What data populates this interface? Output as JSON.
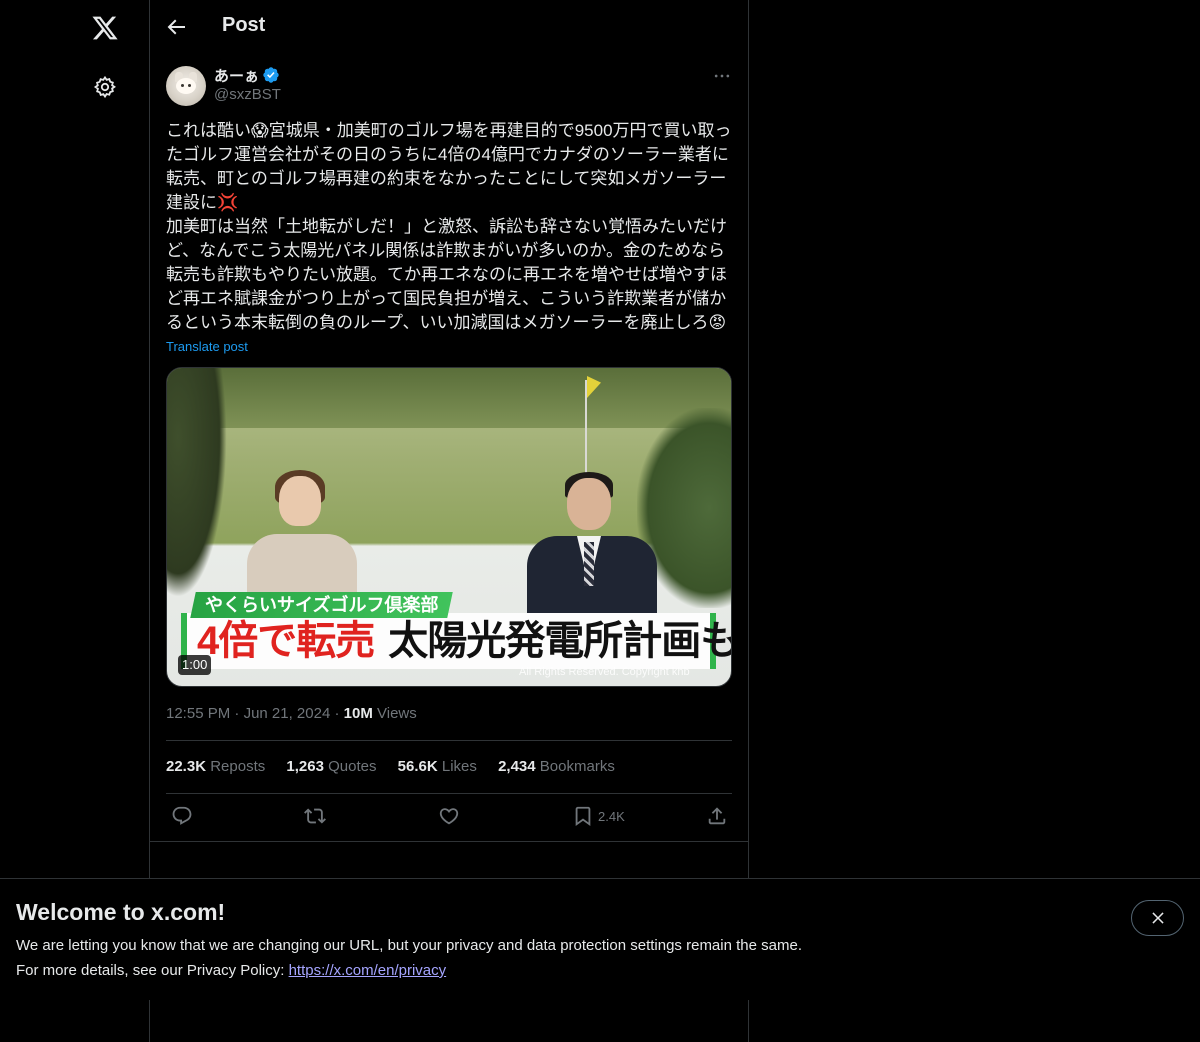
{
  "header": {
    "title": "Post"
  },
  "author": {
    "display_name": "あーぁ",
    "handle": "@sxzBST"
  },
  "tweet": {
    "text": "これは酷い😱宮城県・加美町のゴルフ場を再建目的で9500万円で買い取ったゴルフ運営会社がその日のうちに4倍の4億円でカナダのソーラー業者に転売、町とのゴルフ場再建の約束をなかったことにして突如メガソーラー建設に💢\n加美町は当然「土地転がしだ！」と激怒、訴訟も辞さない覚悟みたいだけど、なんでこう太陽光パネル関係は詐欺まがいが多いのか。金のためなら転売も詐欺もやりたい放題。てか再エネなのに再エネを増やせば増やすほど再エネ賦課金がつり上がって国民負担が増え、こういう詐欺業者が儲かるという本末転倒の負のループ、いい加減国はメガソーラーを廃止しろ😡",
    "translate_label": "Translate post"
  },
  "media": {
    "tag": "やくらいサイズゴルフ倶楽部",
    "caption_red": "4倍で転売",
    "caption_dark": "太陽光発電所計画も",
    "copyright": "All Rights Reserved. Copyright khb",
    "duration": "1:00"
  },
  "meta": {
    "time": "12:55 PM",
    "date": "Jun 21, 2024",
    "views_count": "10M",
    "views_label": "Views"
  },
  "stats": {
    "reposts_count": "22.3K",
    "reposts_label": "Reposts",
    "quotes_count": "1,263",
    "quotes_label": "Quotes",
    "likes_count": "56.6K",
    "likes_label": "Likes",
    "bookmarks_count": "2,434",
    "bookmarks_label": "Bookmarks"
  },
  "actions": {
    "bookmark_count": "2.4K"
  },
  "banner": {
    "title": "Welcome to x.com!",
    "line1": "We are letting you know that we are changing our URL, but your privacy and data protection settings remain the same.",
    "line2_prefix": "For more details, see our Privacy Policy: ",
    "link": "https://x.com/en/privacy"
  },
  "colors": {
    "accent": "#1d9bf0",
    "background": "#000000",
    "border": "#2f3336",
    "muted": "#71767b"
  },
  "icons": [
    "x-logo-icon",
    "gear-icon",
    "back-arrow-icon",
    "verified-badge-icon",
    "more-icon",
    "reply-icon",
    "repost-icon",
    "like-icon",
    "bookmark-icon",
    "share-icon",
    "close-icon"
  ]
}
